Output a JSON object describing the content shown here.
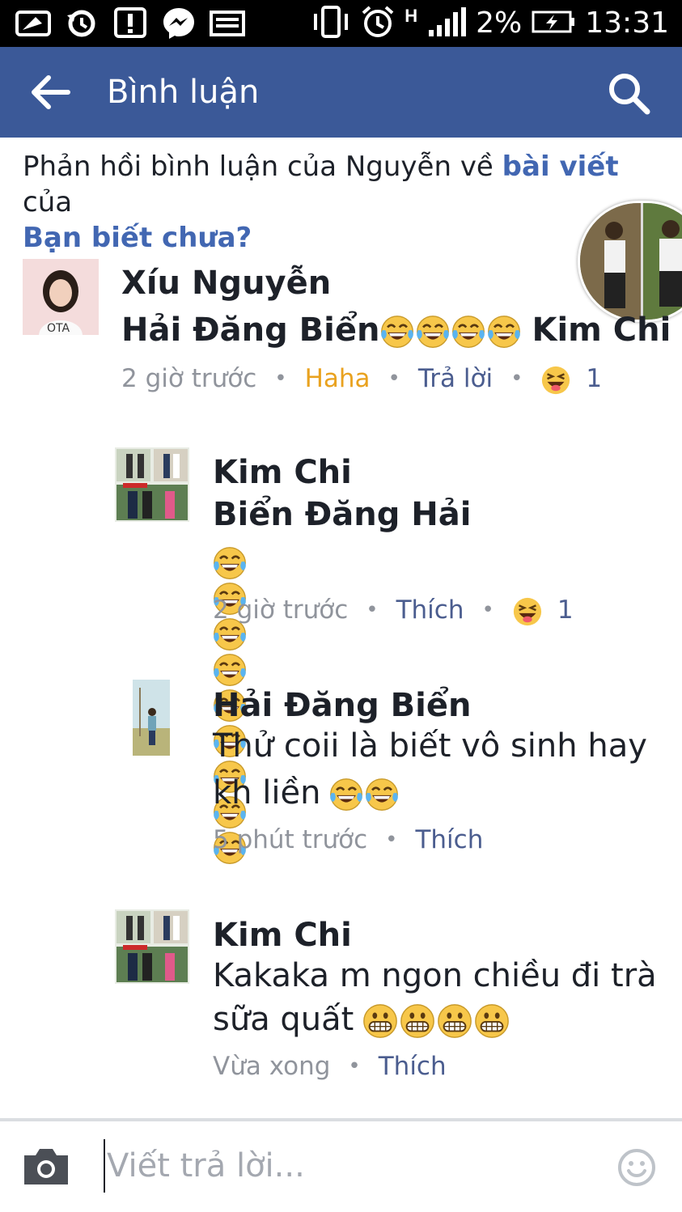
{
  "status_bar": {
    "battery_percent": "2%",
    "time": "13:31",
    "network": "H",
    "icons": [
      "screen-cast-icon",
      "sync-icon",
      "alert-icon",
      "messenger-icon",
      "gallery-icon",
      "vibrate-icon",
      "alarm-icon",
      "signal-icon",
      "battery-charging-icon"
    ]
  },
  "app_bar": {
    "title": "Bình luận",
    "background": "#3b5998"
  },
  "context": {
    "prefix": "Phản hồi bình luận của Nguyễn về ",
    "post_link": "bài viết",
    "middle": " của",
    "page_link": "Bạn biết chưa?"
  },
  "comments": [
    {
      "author": "Xíu Nguyễn",
      "text": "Hải Đăng Biển",
      "emoji_count": 4,
      "text_after": "Kim Chi",
      "time": "2 giờ trước",
      "reaction_label": "Haha",
      "reply_label": "Trả lời",
      "reaction_count": "1"
    },
    {
      "author": "Kim Chi",
      "text": "Biển Đăng Hải",
      "emoji_count": 9,
      "time": "2 giờ trước",
      "like_label": "Thích",
      "reaction_count": "1"
    },
    {
      "author": "Hải Đăng Biển",
      "text_line1": "Thử coii là biết vô sinh hay",
      "text_line2": "kh liền",
      "emoji_count": 2,
      "time": "5 phút trước",
      "like_label": "Thích"
    },
    {
      "author": "Kim Chi",
      "text_line1": "Kakaka m ngon chiều đi trà",
      "text_line2": "sữa quất",
      "emoji_count": 4,
      "time": "Vừa xong",
      "like_label": "Thích"
    }
  ],
  "composer": {
    "placeholder": "Viết trả lời..."
  },
  "colors": {
    "link": "#4267b2",
    "meta": "#90949c",
    "action": "#4b5d8f",
    "haha": "#e9a21f",
    "emoji_yellow": "#f7c74a"
  }
}
